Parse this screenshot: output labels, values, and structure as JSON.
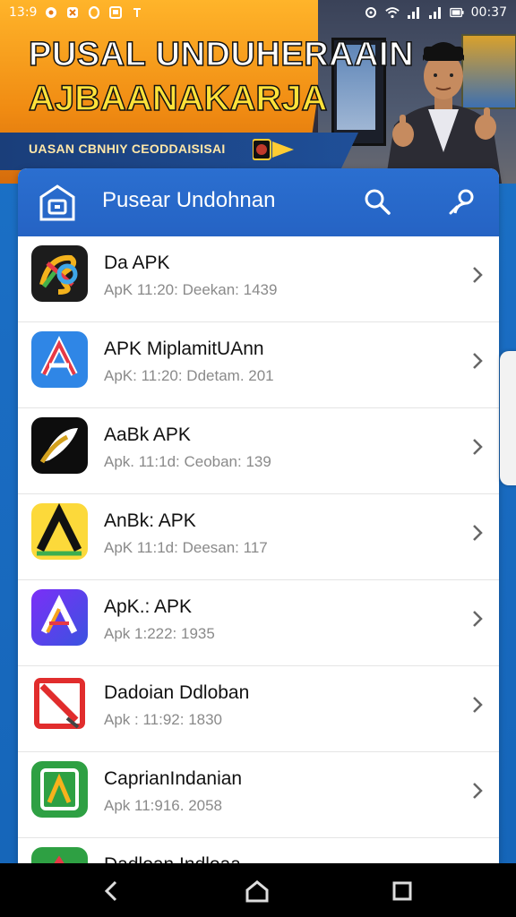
{
  "status_bar": {
    "time": "13:9",
    "clock": "00:37"
  },
  "banner": {
    "title_line1": "PUSAL UNDUHERAAIN",
    "title_line2": "AJBAANAKARJA",
    "subtitle": "UASAN CBNHIY CEODDAISISAI"
  },
  "app_bar": {
    "title": "Pusear Undohnan",
    "search_icon": "search-icon",
    "profile_icon": "profile-search-icon"
  },
  "apps": [
    {
      "name": "Da APK",
      "meta": "ApK 11:20: Deekan: 1439",
      "icon": "colorful-spiral-icon"
    },
    {
      "name": "APK  MiplamitUAnn",
      "meta": "ApK: 11:20: Ddetam. 201",
      "icon": "red-a-icon"
    },
    {
      "name": "AaBk APK",
      "meta": "Apk. 11:1d: Ceoban: 139",
      "icon": "black-feather-icon"
    },
    {
      "name": "AnBk: APK",
      "meta": "ApK 11:1d: Deesan: 117",
      "icon": "yellow-a-icon"
    },
    {
      "name": "ApK.: APK",
      "meta": "Apk 1:222: 1935",
      "icon": "purple-a-icon"
    },
    {
      "name": "Dadoian Ddloban",
      "meta": "Apk : 11:92: 1830",
      "icon": "red-x-icon"
    },
    {
      "name": "CaprianIndanian",
      "meta": "Apk 11:916. 2058",
      "icon": "green-a-icon"
    },
    {
      "name": "Dadloan Indloaa",
      "meta": "",
      "icon": "green-partial-icon"
    }
  ],
  "colors": {
    "app_bar": "#2563c4",
    "background": "#1a6cc2",
    "banner_orange": "#f08b12",
    "title_yellow": "#ffe23a"
  }
}
